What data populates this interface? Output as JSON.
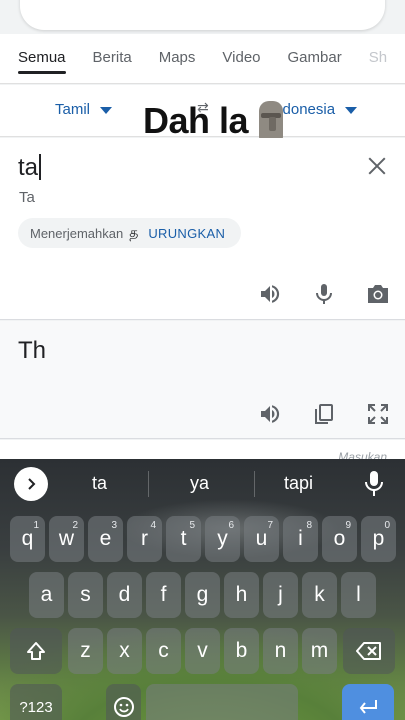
{
  "tabs": [
    {
      "label": "Semua",
      "active": true
    },
    {
      "label": "Berita"
    },
    {
      "label": "Maps"
    },
    {
      "label": "Video"
    },
    {
      "label": "Gambar"
    },
    {
      "label": "Sh"
    }
  ],
  "languages": {
    "source": "Tamil",
    "target": "Indonesia",
    "swap_icon": "swap-arrows-icon"
  },
  "overlay_caption": "Dah la",
  "input": {
    "text": "ta",
    "transliteration": "Ta",
    "chip_text": "Menerjemahkan",
    "chip_char": "த",
    "undo_label": "URUNGKAN"
  },
  "output": {
    "text": "Th",
    "below_hint": "Masukan"
  },
  "keyboard": {
    "suggestions": [
      "ta",
      "ya",
      "tapi"
    ],
    "row1": [
      {
        "k": "q",
        "n": "1"
      },
      {
        "k": "w",
        "n": "2"
      },
      {
        "k": "e",
        "n": "3"
      },
      {
        "k": "r",
        "n": "4"
      },
      {
        "k": "t",
        "n": "5"
      },
      {
        "k": "y",
        "n": "6"
      },
      {
        "k": "u",
        "n": "7"
      },
      {
        "k": "i",
        "n": "8"
      },
      {
        "k": "o",
        "n": "9"
      },
      {
        "k": "p",
        "n": "0"
      }
    ],
    "row2": [
      "a",
      "s",
      "d",
      "f",
      "g",
      "h",
      "j",
      "k",
      "l"
    ],
    "row3": [
      "z",
      "x",
      "c",
      "v",
      "b",
      "n",
      "m"
    ],
    "symbols_label": "?123"
  },
  "colors": {
    "accent_blue": "#1a5ea8",
    "enter_key": "#4f8fe0"
  }
}
